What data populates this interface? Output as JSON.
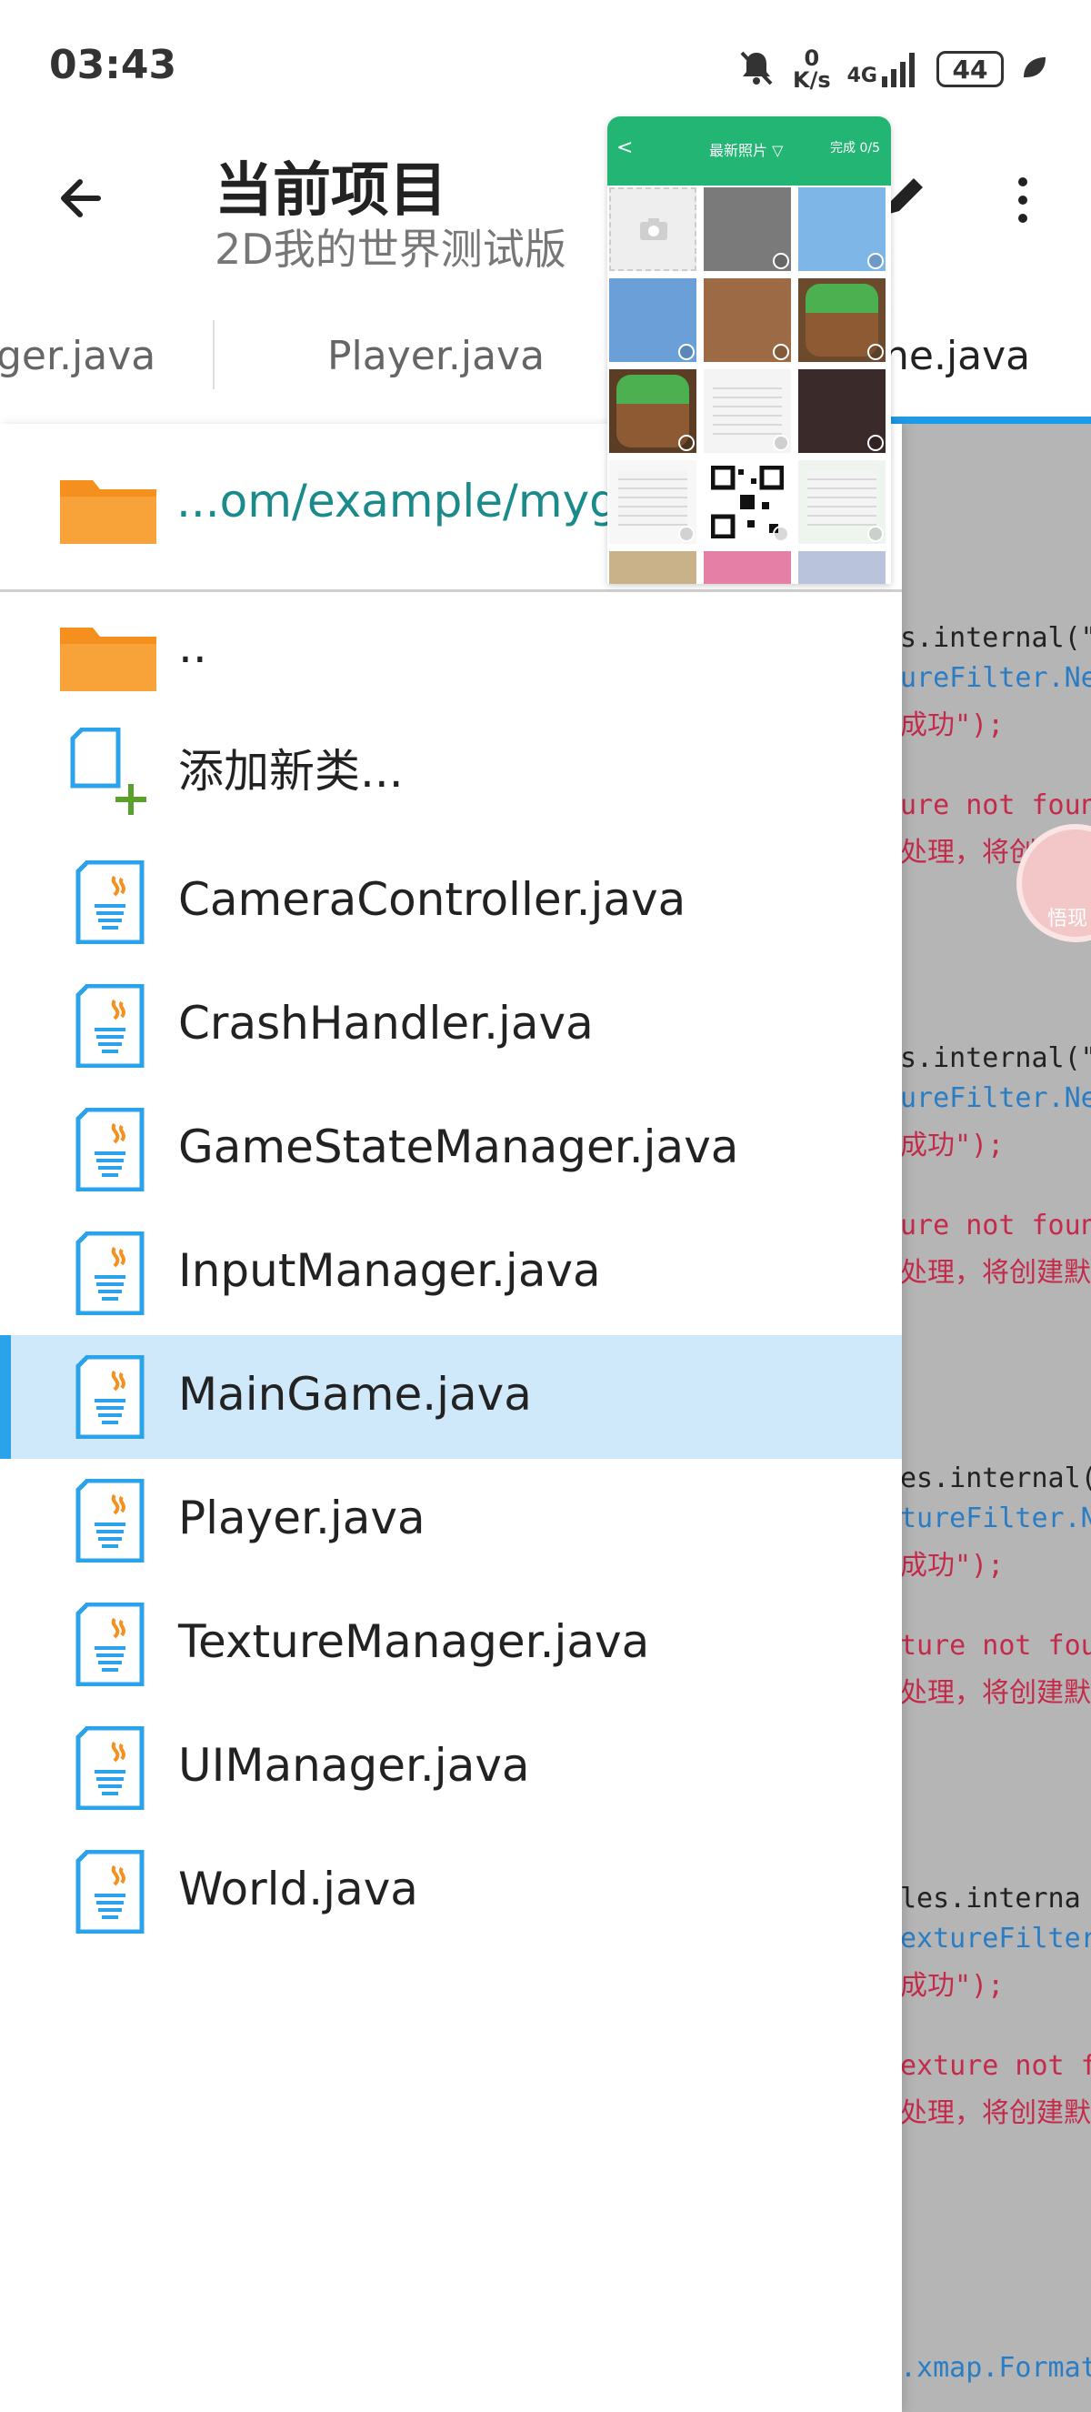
{
  "status_bar": {
    "time": "03:43",
    "net_speed_value": "0",
    "net_speed_unit": "K/s",
    "signal_label": "4G",
    "battery": "44"
  },
  "app_bar": {
    "title": "当前项目",
    "subtitle": "2D我的世界测试版"
  },
  "tabs": [
    {
      "label": "ger.java"
    },
    {
      "label": "Player.java"
    },
    {
      "label": "ne.java"
    }
  ],
  "drawer": {
    "path": "...om/example/myg",
    "parent_dir": "..",
    "add_class": "添加新类...",
    "files": [
      {
        "name": "CameraController.java",
        "selected": false
      },
      {
        "name": "CrashHandler.java",
        "selected": false
      },
      {
        "name": "GameStateManager.java",
        "selected": false
      },
      {
        "name": "InputManager.java",
        "selected": false
      },
      {
        "name": "MainGame.java",
        "selected": true
      },
      {
        "name": "Player.java",
        "selected": false
      },
      {
        "name": "TextureManager.java",
        "selected": false
      },
      {
        "name": "UIManager.java",
        "selected": false
      },
      {
        "name": "World.java",
        "selected": false
      }
    ]
  },
  "editor_lines": [
    {
      "text": "s.internal(\"",
      "color": "black"
    },
    {
      "text": "ureFilter.Ne",
      "color": "blue"
    },
    {
      "text": "成功\");",
      "color": "red"
    },
    {
      "text": "ure not foun",
      "color": "red"
    },
    {
      "text": "处理，将创建默认",
      "color": "red"
    },
    {
      "text": "s.internal(\"",
      "color": "black"
    },
    {
      "text": "ureFilter.Ne",
      "color": "blue"
    },
    {
      "text": "成功\");",
      "color": "red"
    },
    {
      "text": "ure not foun",
      "color": "red"
    },
    {
      "text": "处理，将创建默认",
      "color": "red"
    },
    {
      "text": "es.internal(",
      "color": "black"
    },
    {
      "text": "tureFilter.N",
      "color": "blue"
    },
    {
      "text": "成功\");",
      "color": "red"
    },
    {
      "text": "ture not fou",
      "color": "red"
    },
    {
      "text": "处理，将创建默认",
      "color": "red"
    },
    {
      "text": "les.interna",
      "color": "black"
    },
    {
      "text": "extureFilter",
      "color": "blue"
    },
    {
      "text": "成功\");",
      "color": "red"
    },
    {
      "text": "exture not f",
      "color": "red"
    },
    {
      "text": "处理，将创建默认",
      "color": "red"
    },
    {
      "text": ".xmap.Format",
      "color": "blue"
    }
  ],
  "editor_badge_text": "悟现",
  "photo_picker": {
    "back": "<",
    "title": "最新照片 ▽",
    "done": "完成 0/5",
    "thumbs": [
      {
        "kind": "camera",
        "color": "#eeeeee"
      },
      {
        "kind": "photo",
        "color": "#7a7a7a"
      },
      {
        "kind": "photo",
        "color": "#7fb6e8"
      },
      {
        "kind": "photo",
        "color": "#6a9fd8"
      },
      {
        "kind": "photo",
        "color": "#9c6b45"
      },
      {
        "kind": "app-icon",
        "color": "#6b4a2e"
      },
      {
        "kind": "app-icon",
        "color": "#5a3d24"
      },
      {
        "kind": "screenshot",
        "color": "#f4f4f4"
      },
      {
        "kind": "photo",
        "color": "#3a2a2a"
      },
      {
        "kind": "screenshot",
        "color": "#f7f7f7"
      },
      {
        "kind": "qr-code",
        "color": "#ffffff"
      },
      {
        "kind": "screenshot",
        "color": "#eef5ee"
      },
      {
        "kind": "photo",
        "color": "#c9b28a"
      },
      {
        "kind": "photo",
        "color": "#e67fa6"
      },
      {
        "kind": "photo",
        "color": "#b9c4dc"
      }
    ]
  },
  "colors": {
    "accent": "#1e9be8",
    "selected_row": "#cfe9fb",
    "folder": "#f5901e",
    "path_text": "#1b8a8a",
    "picker_header": "#22b573"
  }
}
